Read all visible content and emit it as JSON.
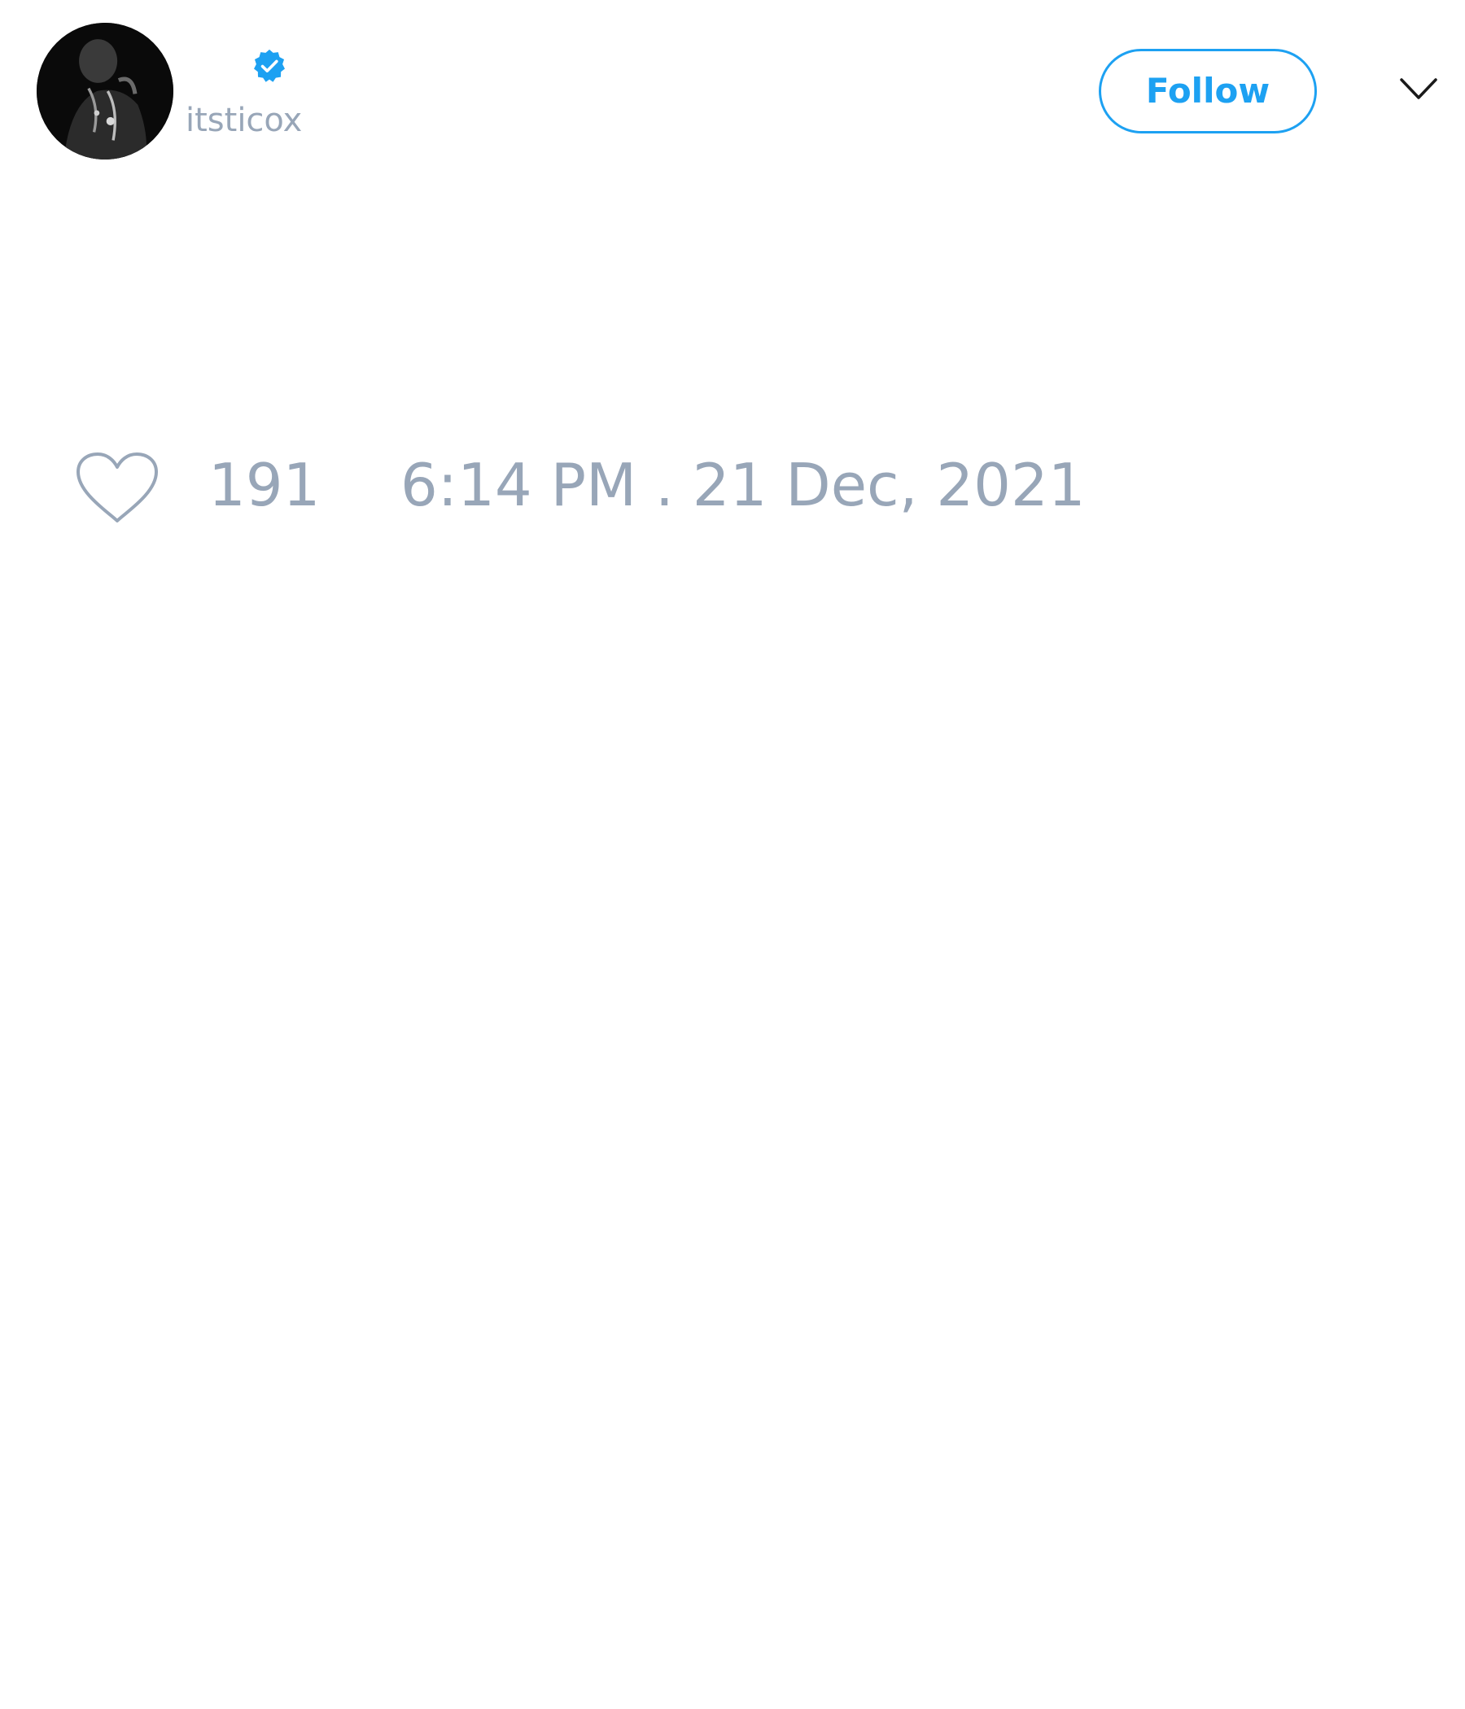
{
  "tweet": {
    "author": {
      "avatar_icon": "user-avatar-photo",
      "verified_icon": "verified-badge-icon",
      "handle": "itsticox"
    },
    "header": {
      "follow_label": "Follow",
      "menu_icon": "chevron-down-icon"
    },
    "footer": {
      "like_icon": "heart-icon",
      "like_count": "191",
      "timestamp": "6:14 PM . 21 Dec, 2021"
    }
  },
  "colors": {
    "accent": "#1da1f2",
    "muted_text": "#98a6b8",
    "background": "#ffffff"
  }
}
